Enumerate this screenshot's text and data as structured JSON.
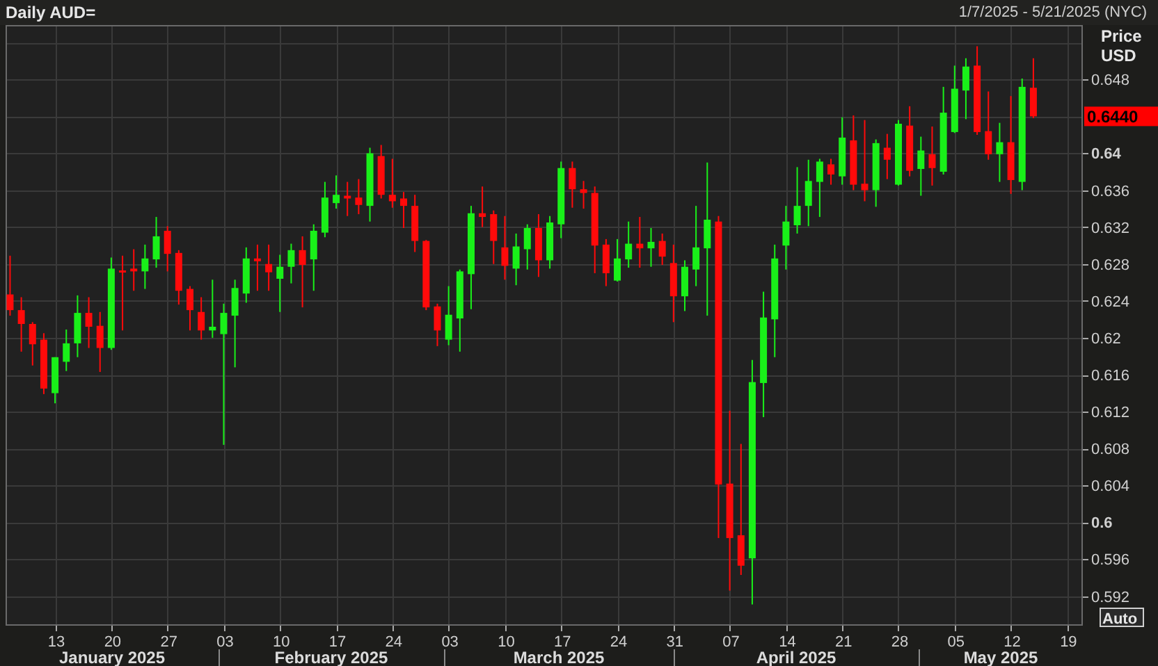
{
  "header": {
    "title": "Daily AUD=",
    "date_range": "1/7/2025 - 5/21/2025 (NYC)"
  },
  "chart": {
    "chart_data": {
      "type": "candlestick",
      "categories": [
        null,
        null,
        null,
        null,
        "13",
        null,
        null,
        null,
        null,
        "20",
        null,
        null,
        null,
        null,
        "27",
        null,
        null,
        null,
        null,
        "03",
        null,
        null,
        null,
        null,
        "10",
        null,
        null,
        null,
        null,
        "17",
        null,
        null,
        null,
        null,
        "24",
        null,
        null,
        null,
        null,
        "03",
        null,
        null,
        null,
        null,
        "10",
        null,
        null,
        null,
        null,
        "17",
        null,
        null,
        null,
        null,
        "24",
        null,
        null,
        null,
        null,
        "31",
        null,
        null,
        null,
        null,
        "07",
        null,
        null,
        null,
        null,
        "14",
        null,
        null,
        null,
        null,
        "21",
        null,
        null,
        null,
        null,
        "28",
        null,
        null,
        null,
        null,
        "05",
        null,
        null,
        null,
        null,
        "12",
        null,
        null,
        null,
        null,
        "19"
      ],
      "ohlc": [
        [
          0.6247,
          0.6289,
          0.6224,
          0.623
        ],
        [
          0.623,
          0.6244,
          0.6185,
          0.6215
        ],
        [
          0.6215,
          0.6217,
          0.617,
          0.6193
        ],
        [
          0.6198,
          0.6205,
          0.6139,
          0.6145
        ],
        [
          0.614,
          0.6179,
          0.6129,
          0.6179
        ],
        [
          0.6174,
          0.6209,
          0.6164,
          0.6194
        ],
        [
          0.6194,
          0.6246,
          0.6179,
          0.6227
        ],
        [
          0.6227,
          0.6244,
          0.6189,
          0.6212
        ],
        [
          0.6213,
          0.6228,
          0.6163,
          0.6189
        ],
        [
          0.6189,
          0.6287,
          0.6187,
          0.6275
        ],
        [
          0.6273,
          0.6289,
          0.6208,
          0.6271
        ],
        [
          0.6275,
          0.6296,
          0.6251,
          0.6272
        ],
        [
          0.6272,
          0.6301,
          0.6253,
          0.6286
        ],
        [
          0.6285,
          0.6331,
          0.6276,
          0.631
        ],
        [
          0.6316,
          0.6321,
          0.6272,
          0.6291
        ],
        [
          0.6292,
          0.6295,
          0.6236,
          0.6251
        ],
        [
          0.6253,
          0.6256,
          0.6208,
          0.623
        ],
        [
          0.6228,
          0.6244,
          0.6198,
          0.6208
        ],
        [
          0.6208,
          0.6263,
          0.62,
          0.6212
        ],
        [
          0.6204,
          0.6237,
          0.6084,
          0.6227
        ],
        [
          0.6224,
          0.6263,
          0.6168,
          0.6254
        ],
        [
          0.6248,
          0.6298,
          0.6238,
          0.6286
        ],
        [
          0.6286,
          0.6301,
          0.6251,
          0.6283
        ],
        [
          0.628,
          0.6301,
          0.6251,
          0.6271
        ],
        [
          0.6264,
          0.629,
          0.6228,
          0.6277
        ],
        [
          0.6277,
          0.6302,
          0.6259,
          0.6295
        ],
        [
          0.6295,
          0.631,
          0.6233,
          0.6279
        ],
        [
          0.6285,
          0.6323,
          0.6251,
          0.6316
        ],
        [
          0.6314,
          0.6369,
          0.6309,
          0.6352
        ],
        [
          0.6346,
          0.6376,
          0.634,
          0.6355
        ],
        [
          0.6354,
          0.6369,
          0.6332,
          0.6351
        ],
        [
          0.6352,
          0.6372,
          0.6334,
          0.6344
        ],
        [
          0.6343,
          0.6406,
          0.6326,
          0.64
        ],
        [
          0.6397,
          0.6409,
          0.6351,
          0.6355
        ],
        [
          0.6355,
          0.6394,
          0.6341,
          0.6348
        ],
        [
          0.6351,
          0.6358,
          0.6319,
          0.6343
        ],
        [
          0.6343,
          0.6355,
          0.6293,
          0.6305
        ],
        [
          0.6305,
          0.6306,
          0.623,
          0.6233
        ],
        [
          0.6234,
          0.6237,
          0.6191,
          0.6208
        ],
        [
          0.6198,
          0.6256,
          0.6192,
          0.6225
        ],
        [
          0.6221,
          0.6274,
          0.6185,
          0.6272
        ],
        [
          0.6269,
          0.6343,
          0.6231,
          0.6335
        ],
        [
          0.6335,
          0.6364,
          0.632,
          0.6331
        ],
        [
          0.6334,
          0.6338,
          0.628,
          0.6305
        ],
        [
          0.6298,
          0.6332,
          0.6263,
          0.6278
        ],
        [
          0.6275,
          0.6313,
          0.6257,
          0.6299
        ],
        [
          0.6296,
          0.6323,
          0.6274,
          0.6319
        ],
        [
          0.6319,
          0.6334,
          0.6266,
          0.6284
        ],
        [
          0.6284,
          0.6332,
          0.6275,
          0.6325
        ],
        [
          0.6323,
          0.6391,
          0.6308,
          0.6384
        ],
        [
          0.6384,
          0.6391,
          0.6341,
          0.6361
        ],
        [
          0.6361,
          0.637,
          0.634,
          0.6357
        ],
        [
          0.6357,
          0.6364,
          0.627,
          0.63
        ],
        [
          0.6301,
          0.6307,
          0.6256,
          0.627
        ],
        [
          0.6262,
          0.6307,
          0.6261,
          0.6286
        ],
        [
          0.6285,
          0.6326,
          0.6276,
          0.6302
        ],
        [
          0.6302,
          0.6331,
          0.6276,
          0.6297
        ],
        [
          0.6297,
          0.6319,
          0.6277,
          0.6304
        ],
        [
          0.6305,
          0.6313,
          0.6279,
          0.6288
        ],
        [
          0.6281,
          0.6301,
          0.6217,
          0.6245
        ],
        [
          0.6245,
          0.6284,
          0.6229,
          0.6277
        ],
        [
          0.6274,
          0.6343,
          0.6256,
          0.6298
        ],
        [
          0.6297,
          0.639,
          0.6224,
          0.6328
        ],
        [
          0.6326,
          0.6332,
          0.5983,
          0.6041
        ],
        [
          0.6042,
          0.6121,
          0.5926,
          0.5983
        ],
        [
          0.5986,
          0.6085,
          0.5943,
          0.5953
        ],
        [
          0.5961,
          0.6176,
          0.5911,
          0.6152
        ],
        [
          0.6151,
          0.625,
          0.6114,
          0.6222
        ],
        [
          0.622,
          0.6301,
          0.6179,
          0.6286
        ],
        [
          0.63,
          0.6343,
          0.6274,
          0.6326
        ],
        [
          0.6322,
          0.6385,
          0.6313,
          0.6343
        ],
        [
          0.6343,
          0.6393,
          0.6321,
          0.637
        ],
        [
          0.6369,
          0.6394,
          0.6331,
          0.6391
        ],
        [
          0.6388,
          0.6394,
          0.6366,
          0.6377
        ],
        [
          0.6375,
          0.6439,
          0.6366,
          0.6417
        ],
        [
          0.6414,
          0.6441,
          0.636,
          0.6366
        ],
        [
          0.6367,
          0.6436,
          0.6348,
          0.636
        ],
        [
          0.636,
          0.6415,
          0.6342,
          0.6411
        ],
        [
          0.6406,
          0.6421,
          0.6372,
          0.6393
        ],
        [
          0.6366,
          0.6436,
          0.6365,
          0.6432
        ],
        [
          0.643,
          0.6451,
          0.6375,
          0.6381
        ],
        [
          0.6383,
          0.6418,
          0.6354,
          0.6403
        ],
        [
          0.6399,
          0.6429,
          0.6365,
          0.6384
        ],
        [
          0.638,
          0.6472,
          0.6377,
          0.6444
        ],
        [
          0.6423,
          0.6495,
          0.6422,
          0.647
        ],
        [
          0.6468,
          0.6503,
          0.6437,
          0.6494
        ],
        [
          0.6495,
          0.6516,
          0.642,
          0.6423
        ],
        [
          0.6424,
          0.6467,
          0.6393,
          0.6399
        ],
        [
          0.6399,
          0.6433,
          0.6369,
          0.6412
        ],
        [
          0.6412,
          0.6462,
          0.6356,
          0.6371
        ],
        [
          0.6369,
          0.6481,
          0.636,
          0.6472
        ],
        [
          0.6471,
          0.6503,
          0.6438,
          0.644
        ],
        null,
        null,
        null
      ],
      "ylim": [
        0.5888,
        0.6539
      ],
      "grid": true,
      "yticks": [
        {
          "value": 0.648,
          "label": "0.648"
        },
        {
          "value": 0.64,
          "label": "0.64"
        },
        {
          "value": 0.636,
          "label": "0.636"
        },
        {
          "value": 0.632,
          "label": "0.632"
        },
        {
          "value": 0.628,
          "label": "0.628"
        },
        {
          "value": 0.624,
          "label": "0.624"
        },
        {
          "value": 0.62,
          "label": "0.62"
        },
        {
          "value": 0.616,
          "label": "0.616"
        },
        {
          "value": 0.612,
          "label": "0.612"
        },
        {
          "value": 0.608,
          "label": "0.608"
        },
        {
          "value": 0.604,
          "label": "0.604"
        },
        {
          "value": 0.6,
          "label": "0.6"
        },
        {
          "value": 0.596,
          "label": "0.596"
        },
        {
          "value": 0.592,
          "label": "0.592"
        }
      ]
    },
    "months": [
      "January 2025",
      "February 2025",
      "March 2025",
      "April 2025",
      "May 2025"
    ],
    "price_axis": {
      "title_lines": [
        "Price",
        "USD"
      ],
      "last_price": "0.6440",
      "scale_button": "Auto"
    }
  }
}
